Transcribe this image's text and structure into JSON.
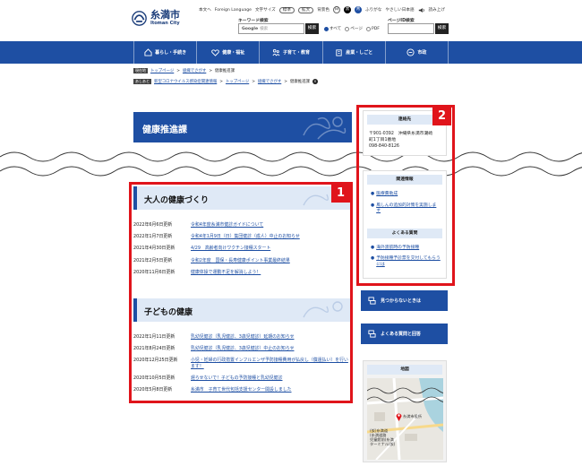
{
  "header": {
    "logo_jp": "糸満市",
    "logo_en": "Itoman City",
    "util": {
      "home": "本文へ",
      "foreign": "Foreign Language",
      "font_size_label": "文字サイズ",
      "font_standard": "標準",
      "font_large": "拡大",
      "bg_color_label": "背景色",
      "bg_white": "白",
      "bg_black": "黒",
      "bg_blue": "青",
      "furigana": "ふりがな",
      "easy_japanese": "やさしい日本語",
      "read_aloud": "読み上げ"
    },
    "keyword_search_label": "キーワード検索",
    "keyword_google": "Google",
    "keyword_placeholder": "検索",
    "search_button": "検索",
    "radio_all": "すべて",
    "radio_page": "ページ",
    "radio_pdf": "PDF",
    "page_id_label": "ページID検索",
    "page_id_button": "検索"
  },
  "nav": {
    "items": [
      {
        "label": "暮らし・手続き"
      },
      {
        "label": "健康・福祉"
      },
      {
        "label": "子育て・教育"
      },
      {
        "label": "産業・しごと"
      },
      {
        "label": "市政"
      }
    ]
  },
  "breadcrumb1": {
    "tag": "現在地",
    "links": [
      "トップページ",
      "組織でさがす"
    ],
    "current": "健康推進課"
  },
  "breadcrumb2": {
    "tag": "あしあと",
    "links": [
      "新型コロナウイルス感染症関連情報",
      "トップページ",
      "組織でさがす"
    ],
    "current": "健康推進課",
    "close": "×"
  },
  "page_title": "健康推進課",
  "adult_section": {
    "title": "大人の健康づくり",
    "items": [
      {
        "date": "2022年6月6日更新",
        "text": "令和4年度糸満市健診ガイドについて"
      },
      {
        "date": "2022年1月7日更新",
        "text": "令和4年1月9日（日）集団健診（成人）中止のお知らせ"
      },
      {
        "date": "2021年4月30日更新",
        "text": "4/29　高齢者向けワクチン接種スタート"
      },
      {
        "date": "2021年2月5日更新",
        "text": "令和2年度　国保・長寿健康ポイント事業最終結果"
      },
      {
        "date": "2020年11月6日更新",
        "text": "健康体操で運動不足を解消しよう！"
      }
    ]
  },
  "child_section": {
    "title": "子どもの健康",
    "items": [
      {
        "date": "2022年1月11日更新",
        "text": "乳幼児健診（乳児健診、3歳児健診）延期のお知らせ"
      },
      {
        "date": "2021年8月24日更新",
        "text": "乳幼児健診（乳児健診、3歳児健診）中止のお知らせ"
      },
      {
        "date": "2020年12月25日更新",
        "text": "小児・妊婦の行政措置インフルエンザ予防接種費用が払戻し（償還払い）を行います！"
      },
      {
        "date": "2020年10月5日更新",
        "text": "遅らせないで！子どもの予防接種と乳幼児健診"
      },
      {
        "date": "2020年5月8日更新",
        "text": "糸満市　子育て世代包括支援センター開設しました"
      }
    ]
  },
  "contact": {
    "head": "連絡先",
    "lines": [
      "〒901-0392　沖縄県糸満市潮崎",
      "町1丁目1番地",
      "098-840-8126"
    ]
  },
  "related": {
    "head": "関連情報",
    "items": [
      "医療費助成",
      "風しんの追加的対策を実施します"
    ]
  },
  "faq": {
    "head": "よくある質問",
    "items": [
      "海外渡航時の予防接種",
      "予防接種予診票を交付してもらうには"
    ]
  },
  "buttons": {
    "not_found": "見つからないときは",
    "faq_and_answers": "よくある質問と回答"
  },
  "map": {
    "head": "地図",
    "label_hall": "糸満市役所",
    "label_left": "(仮)糸満道\n(糸満道路\n児童館前)糸満\nターミナル(仮)"
  },
  "annotations": {
    "badge1": "1",
    "badge2": "2"
  },
  "colors": {
    "brand_blue": "#1e4fa3",
    "highlight_red": "#e0141b",
    "section_bg": "#dfe9f6"
  }
}
